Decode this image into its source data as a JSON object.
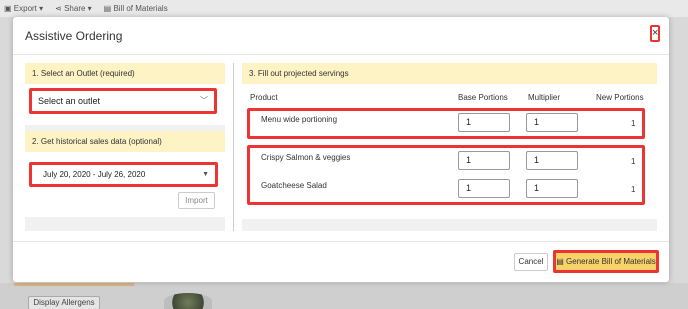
{
  "toolbar": {
    "export": "Export ▾",
    "share": "Share ▾",
    "bill": "Bill of Materials"
  },
  "background": {
    "display_allergens": "Display Allergens"
  },
  "modal": {
    "title": "Assistive Ordering",
    "close": "×"
  },
  "outlet": {
    "heading": "1. Select an Outlet (required)",
    "selected": "Select an outlet"
  },
  "history": {
    "heading": "2. Get historical sales data (optional)",
    "date_range": "July 20, 2020 - July 26, 2020",
    "import_label": "Import"
  },
  "servings": {
    "heading": "3. Fill out projected servings",
    "columns": [
      "Product",
      "Base Portions",
      "Multiplier",
      "New Portions"
    ],
    "rows": [
      {
        "product": "Menu wide portioning",
        "base": "1",
        "multiplier": "1",
        "new": "1"
      },
      {
        "product": "Crispy Salmon & veggies",
        "base": "1",
        "multiplier": "1",
        "new": "1"
      },
      {
        "product": "Goatcheese Salad",
        "base": "1",
        "multiplier": "1",
        "new": "1"
      }
    ]
  },
  "footer": {
    "cancel": "Cancel",
    "generate": "Generate Bill of Materials"
  },
  "colors": {
    "highlight": "#e33333",
    "section_header": "#fdf3c4",
    "primary_button": "#f7d36a"
  }
}
